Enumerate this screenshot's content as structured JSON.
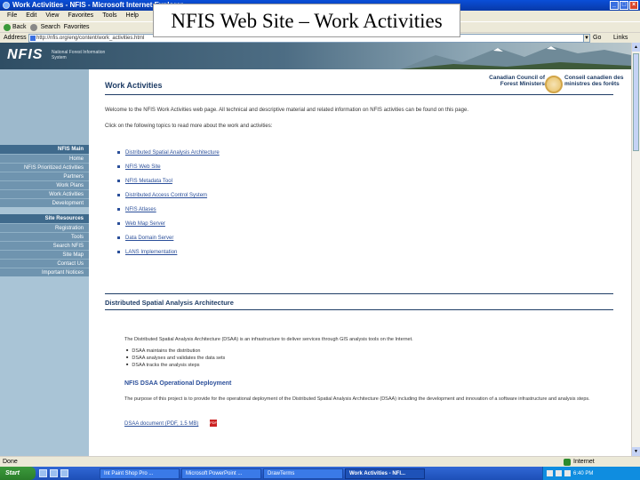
{
  "browser": {
    "window_title": "Work Activities - NFIS - Microsoft Internet Explorer",
    "menu": [
      "File",
      "Edit",
      "View",
      "Favorites",
      "Tools",
      "Help"
    ],
    "toolbar": [
      "Back",
      "Search",
      "Favorites"
    ],
    "address_label": "Address",
    "address_value": "http://nfis.org/eng/content/work_activities.html",
    "go_label": "Go",
    "links_label": "Links",
    "status_left": "Done",
    "status_zone": "Internet"
  },
  "slide_title": "NFIS Web Site – Work Activities",
  "site": {
    "logo": "NFIS",
    "logo_sub": "National Forest Information System",
    "page_title": "Work Activities",
    "ccfm_en": "Canadian Council of Forest Ministers",
    "ccfm_fr": "Conseil canadien des ministres des forêts",
    "nav_groups": [
      {
        "title": "NFIS Main",
        "items": [
          "Home",
          "NFIS Prioritized Activities",
          "Partners",
          "Work Plans",
          "Work Activities",
          "Development"
        ]
      },
      {
        "title": "Site Resources",
        "items": [
          "Registration",
          "Tools",
          "Search NFIS",
          "Site Map",
          "Contact Us",
          "Important Notices"
        ]
      }
    ],
    "intro": "Welcome to the NFIS Work Activities web page. All technical and descriptive material and related information on NFIS activities can be found on this page.",
    "intro2": "Click on the following topics to read more about the work and activities:",
    "activities": [
      "Distributed Spatial Analysis Architecture",
      "NFIS Web Site",
      "NFIS Metadata Tool",
      "Distributed Access Control System",
      "NFIS Atlases",
      "Web Map Server",
      "Data Domain Server",
      "LANS Implementation"
    ],
    "section1_title": "Distributed Spatial Analysis Architecture",
    "section1_text": "The Distributed Spatial Analysis Architecture (DSAA) is an infrastructure to deliver services through GIS analysis tools on the Internet.",
    "section1_bullets": [
      "DSAA maintains the distribution",
      "DSAA analyses and validates the data sets",
      "DSAA tracks the analysis steps"
    ],
    "section1_sub": "NFIS DSAA Operational Deployment",
    "section1_sub_text": "The purpose of this project is to provide for the operational deployment of the Distributed Spatial Analysis Architecture (DSAA) including the development and innovation of a software infrastructure and analysis steps.",
    "pdf_link": "DSAA document (PDF, 1.5 MB)"
  },
  "taskbar": {
    "start": "Start",
    "tasks": [
      "Int Paint Shop Pro ...",
      "Microsoft PowerPoint ...",
      "DrawTerms",
      "Work Activities - NFI..."
    ],
    "tray_time": "6:40 PM"
  }
}
